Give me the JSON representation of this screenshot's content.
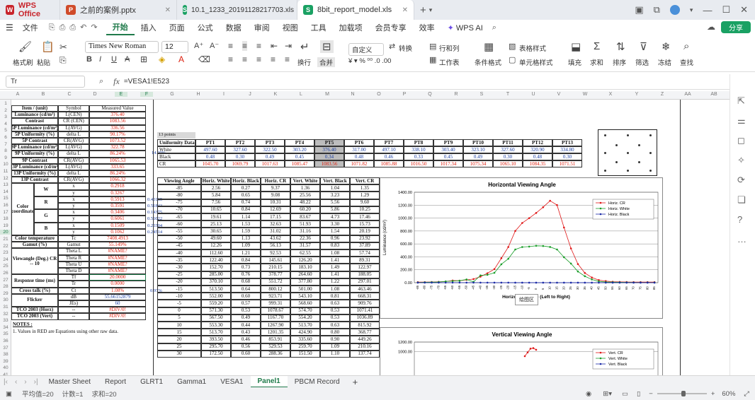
{
  "tabs": [
    {
      "label": "WPS Office",
      "icon": "wps-logo-icon"
    },
    {
      "label": "之前的案例.pptx",
      "icon": "ppt-icon"
    },
    {
      "label": "10.1_1233_20191128217703.xls",
      "icon": "sheet-icon"
    },
    {
      "label": "8bit_report_model.xls",
      "icon": "sheet-icon"
    }
  ],
  "menu": [
    "文件",
    "开始",
    "插入",
    "页面",
    "公式",
    "数据",
    "审阅",
    "视图",
    "工具",
    "加载项",
    "会员专享",
    "效率",
    "WPS AI"
  ],
  "share_label": "分享",
  "ribbon": {
    "font": "Times New Roman",
    "size": "12",
    "labels": [
      "格式刷",
      "粘贴",
      "自定义",
      "转换",
      "行和列",
      "工作表",
      "条件格式",
      "单元格样式",
      "表格样式",
      "填充",
      "求和",
      "排序",
      "筛选",
      "冻结",
      "查找",
      "换行",
      "合并"
    ]
  },
  "namebox": "Tr",
  "formula": "=VESA1!E523",
  "columns": [
    "A",
    "B",
    "C",
    "D",
    "E",
    "F",
    "G",
    "H",
    "I",
    "J",
    "K",
    "L",
    "M",
    "N",
    "O",
    "P",
    "Q",
    "R",
    "S",
    "T",
    "U",
    "V",
    "W",
    "X",
    "Y",
    "Z",
    "AA",
    "AB",
    "AC"
  ],
  "rows": [
    "1",
    "2",
    "3",
    "4",
    "5",
    "6",
    "7",
    "8",
    "9",
    "10",
    "11",
    "12",
    "13",
    "14",
    "15",
    "16",
    "17",
    "18",
    "19",
    "20",
    "21",
    "22",
    "23",
    "24",
    "25",
    "26",
    "27",
    "28",
    "29",
    "30",
    "31",
    "32",
    "33",
    "34",
    "35",
    "36",
    "37",
    "38",
    "39",
    "40",
    "41"
  ],
  "left_table": {
    "header": [
      "Item / (unit)",
      "Symbol",
      "Measured Value"
    ],
    "rows": [
      [
        "Luminance (cd/m²)",
        "L(CEN)",
        "376.40"
      ],
      [
        "Contrast",
        "CR (CEN)",
        "1083.56"
      ],
      [
        "5P Luminance (cd/m²)",
        "L(AVG)",
        "336.56"
      ],
      [
        "5P Uniformity (%)",
        "delta L",
        "90.17%"
      ],
      [
        "5P Contrast",
        "CR(AVG)",
        "1073.52"
      ],
      [
        "9P Luminance (cd/m²)",
        "L(AVG)",
        "322.78"
      ],
      [
        "9P Uniformity (%)",
        "delta L",
        "86.24%"
      ],
      [
        "9P Contrast",
        "CR(AVG)",
        "1065.53"
      ],
      [
        "13P Luminance (cd/m²)",
        "L(AVG)",
        "333.65"
      ],
      [
        "13P Uniformity (%)",
        "delta L",
        "86.24%"
      ],
      [
        "13P Contrast",
        "CR(AVG)",
        "1066.32"
      ]
    ],
    "extra_pct": "14.99%",
    "color_label": "Color coordinate",
    "color_rows": [
      [
        "W",
        "x",
        "0.2918",
        ""
      ],
      [
        "",
        "y",
        "0.3267",
        ""
      ],
      [
        "R",
        "x",
        "0.5913",
        "0.40165"
      ],
      [
        "",
        "y",
        "0.3591",
        "0.51843"
      ],
      [
        "G",
        "x",
        "0.3406",
        "0.14375"
      ],
      [
        "",
        "y",
        "0.6061",
        "0.56022"
      ],
      [
        "B",
        "x",
        "0.1509",
        "0.20304"
      ],
      [
        "",
        "y",
        "0.1062",
        "0.24514"
      ]
    ],
    "ct": [
      "Color temperature",
      "Tc",
      "7408.4913"
    ],
    "gamut": [
      "Gamut (%)",
      "Gamut",
      "55.149%"
    ],
    "view_label": "Viewangle (Deg.) CR -- 10",
    "view_rows": [
      [
        "Theta L",
        "#NAME?"
      ],
      [
        "Theta R",
        "#NAME?"
      ],
      [
        "Theta U",
        "#NAME?"
      ],
      [
        "Theta D",
        "#NAME?"
      ]
    ],
    "resp_label": "Response time (ms)",
    "resp_rows": [
      [
        "Tf",
        "20.0000"
      ],
      [
        "Tr",
        "0.0000"
      ]
    ],
    "crosstalk": [
      "Cross talk (%)",
      "Ct",
      "1.08%"
    ],
    "crosstalk_extra": "0.97%",
    "flicker_label": "Flicker",
    "flicker_rows": [
      [
        "dB",
        "55.66152879"
      ],
      [
        "JEs)",
        "60"
      ]
    ],
    "tco": [
      [
        "TCO 2003 (Horz)",
        "--",
        "#DIV/0!"
      ],
      [
        "TCO 2003 (Vert)",
        "--",
        "#DIV/0!"
      ]
    ],
    "notes_title": "NOTES :",
    "notes_1": "1. Values in RED are Equations using other raw data."
  },
  "uniformity": {
    "caption": "13 points",
    "header": [
      "Uniformity Data",
      "PT1",
      "PT2",
      "PT3",
      "PT4",
      "PT5",
      "PT6",
      "PT7",
      "PT8",
      "PT9",
      "PT10",
      "PT11",
      "PT12",
      "PT13"
    ],
    "rows": [
      [
        "White",
        "497.60",
        "327.60",
        "322.50",
        "303.20",
        "376.40",
        "317.00",
        "497.10",
        "338.10",
        "303.40",
        "323.10",
        "327.60",
        "320.90",
        "334.80"
      ],
      [
        "Black",
        "0.48",
        "0.30",
        "0.49",
        "0.45",
        "0.34",
        "0.48",
        "0.46",
        "0.33",
        "0.45",
        "0.49",
        "0.30",
        "0.48",
        "0.30"
      ],
      [
        "CR",
        "1045.70",
        "1069.79",
        "1017.63",
        "1085.47",
        "1083.56",
        "1071.82",
        "1085.88",
        "1016.50",
        "1017.34",
        "1075.34",
        "1065.10",
        "1084.35",
        "1071.51"
      ]
    ]
  },
  "viewing_table": {
    "header": [
      "Viewing Angle",
      "Horiz. White",
      "Horiz. Black",
      "Horiz. CR",
      "Vert. White",
      "Vert. Black",
      "Vert. CR"
    ],
    "rows": [
      [
        "-85",
        "2.56",
        "0.27",
        "9.37",
        "1.36",
        "1.04",
        "1.35"
      ],
      [
        "-80",
        "5.84",
        "0.65",
        "9.08",
        "25.56",
        "3.23",
        "1.29"
      ],
      [
        "-75",
        "7.56",
        "0.74",
        "10.31",
        "48.22",
        "5.56",
        "9.60"
      ],
      [
        "-70",
        "10.65",
        "0.84",
        "12.69",
        "60.20",
        "5.86",
        "10.25"
      ],
      [
        "-65",
        "19.61",
        "1.14",
        "17.15",
        "83.67",
        "4.73",
        "17.46"
      ],
      [
        "-60",
        "25.13",
        "1.53",
        "32.63",
        "51.93",
        "3.30",
        "15.73"
      ],
      [
        "-55",
        "30.65",
        "1.59",
        "31.02",
        "31.16",
        "1.54",
        "20.19"
      ],
      [
        "-50",
        "49.60",
        "1.13",
        "43.62",
        "22.36",
        "0.96",
        "23.92"
      ],
      [
        "-45",
        "12.26",
        "1.09",
        "56.13",
        "31.57",
        "0.83",
        "37.89"
      ],
      [
        "-40",
        "112.60",
        "1.21",
        "92.53",
        "62.55",
        "1.08",
        "57.74"
      ],
      [
        "-35",
        "122.40",
        "0.84",
        "145.61",
        "126.20",
        "1.41",
        "89.31"
      ],
      [
        "-30",
        "152.70",
        "0.73",
        "210.15",
        "183.10",
        "1.49",
        "122.97"
      ],
      [
        "-25",
        "285.00",
        "0.76",
        "378.77",
        "264.60",
        "1.41",
        "188.05"
      ],
      [
        "-20",
        "370.10",
        "0.68",
        "551.72",
        "377.80",
        "1.22",
        "297.01"
      ],
      [
        "-15",
        "513.50",
        "0.64",
        "800.12",
        "501.00",
        "1.08",
        "463.46"
      ],
      [
        "-10",
        "552.00",
        "0.60",
        "923.71",
        "543.10",
        "0.81",
        "668.31"
      ],
      [
        "-5",
        "559.20",
        "0.57",
        "999.31",
        "568.60",
        "0.63",
        "909.76"
      ],
      [
        "0",
        "571.30",
        "0.53",
        "1078.67",
        "574.70",
        "0.53",
        "1071.41"
      ],
      [
        "5",
        "567.50",
        "0.49",
        "1167.70",
        "554.20",
        "0.53",
        "1036.89"
      ],
      [
        "10",
        "553.30",
        "0.44",
        "1267.90",
        "513.70",
        "0.63",
        "815.92"
      ],
      [
        "15",
        "513.70",
        "0.43",
        "1201.35",
        "424.90",
        "0.80",
        "368.77"
      ],
      [
        "20",
        "393.50",
        "0.46",
        "853.91",
        "335.60",
        "0.90",
        "449.26"
      ],
      [
        "25",
        "295.70",
        "0.56",
        "529.53",
        "259.70",
        "1.09",
        "210.16"
      ],
      [
        "30",
        "172.50",
        "0.60",
        "288.36",
        "151.50",
        "1.10",
        "137.74"
      ]
    ]
  },
  "chart_data": [
    {
      "type": "line",
      "title": "Horizontal Viewing Angle",
      "xlabel": "Horizontal Angle (Left to Right)",
      "ylabel": "Luminance (cd/m²)",
      "ylim": [
        0,
        1400
      ],
      "yticks": [
        "0.00",
        "200.00",
        "400.00",
        "600.00",
        "800.00",
        "1000.00",
        "1200.00",
        "1400.00"
      ],
      "x": [
        -85,
        -80,
        -75,
        -70,
        -65,
        -60,
        -55,
        -50,
        -45,
        -40,
        -35,
        -30,
        -25,
        -20,
        -15,
        -10,
        -5,
        0,
        5,
        10,
        15,
        20,
        25,
        30,
        35,
        40,
        45,
        50,
        55,
        60,
        65,
        70,
        75,
        80,
        85
      ],
      "series": [
        {
          "name": "Horiz. CR",
          "color": "#e01818",
          "values": [
            9,
            9,
            10,
            13,
            17,
            33,
            31,
            44,
            56,
            93,
            146,
            210,
            379,
            552,
            800,
            924,
            999,
            1079,
            1168,
            1268,
            1201,
            854,
            530,
            288,
            150,
            80,
            40,
            25,
            15,
            12,
            10,
            9,
            9,
            9,
            9
          ]
        },
        {
          "name": "Horiz. White",
          "color": "#1a9e2a",
          "values": [
            3,
            6,
            8,
            11,
            20,
            25,
            31,
            50,
            12,
            113,
            122,
            153,
            285,
            370,
            514,
            552,
            559,
            571,
            568,
            553,
            514,
            394,
            296,
            173,
            100,
            50,
            20,
            10,
            8,
            6,
            5,
            4,
            3,
            3,
            3
          ]
        },
        {
          "name": "Horiz. Black",
          "color": "#1b2aa8",
          "values": [
            0.3,
            0.7,
            0.7,
            0.8,
            1.1,
            1.5,
            1.6,
            1.1,
            1.1,
            1.2,
            0.8,
            0.7,
            0.8,
            0.7,
            0.6,
            0.6,
            0.6,
            0.5,
            0.5,
            0.4,
            0.4,
            0.5,
            0.6,
            0.6,
            0.6,
            0.6,
            0.6,
            0.6,
            0.6,
            0.6,
            0.6,
            0.6,
            0.6,
            0.6,
            0.6
          ]
        }
      ],
      "legend": "top-right",
      "tooltip": "绘图区"
    },
    {
      "type": "line",
      "title": "Vertical Viewing Angle",
      "ylim": [
        0,
        1200
      ],
      "yticks": [
        "1000.00",
        "1200.00"
      ],
      "series": [
        {
          "name": "Vert. CR",
          "color": "#e01818"
        },
        {
          "name": "Vert. White",
          "color": "#1a9e2a"
        },
        {
          "name": "Vert. Black",
          "color": "#1b2aa8"
        }
      ],
      "legend": "top-right"
    }
  ],
  "sheet_tabs": [
    "Master Sheet",
    "Report",
    "GLRT1",
    "Gamma1",
    "VESA1",
    "Panel1",
    "PBCM Record"
  ],
  "active_sheet": "Panel1",
  "status": {
    "avg": "平均值=20",
    "count": "计数=1",
    "sum": "求和=20",
    "zoom": "60%"
  }
}
